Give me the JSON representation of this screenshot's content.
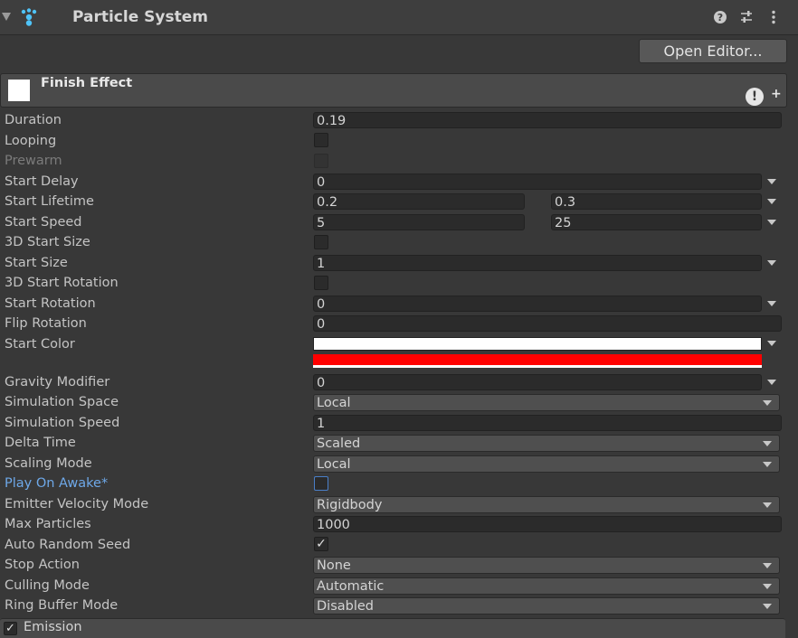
{
  "component": {
    "title": "Particle System",
    "open_editor_label": "Open Editor...",
    "help_icon": "help-icon",
    "presets_icon": "presets-icon",
    "menu_icon": "kebab-menu-icon"
  },
  "module": {
    "name": "Finish Effect",
    "swatch_color": "#ffffff",
    "warning_glyph": "!",
    "plus_glyph": "+"
  },
  "rows": {
    "duration": {
      "label": "Duration",
      "value": "0.19"
    },
    "looping": {
      "label": "Looping",
      "checked": false
    },
    "prewarm": {
      "label": "Prewarm",
      "checked": false,
      "disabled": true
    },
    "start_delay": {
      "label": "Start Delay",
      "value": "0"
    },
    "start_lifetime": {
      "label": "Start Lifetime",
      "min": "0.2",
      "max": "0.3"
    },
    "start_speed": {
      "label": "Start Speed",
      "min": "5",
      "max": "25"
    },
    "start_size_3d": {
      "label": "3D Start Size",
      "checked": false
    },
    "start_size": {
      "label": "Start Size",
      "value": "1"
    },
    "start_rotation_3d": {
      "label": "3D Start Rotation",
      "checked": false
    },
    "start_rotation": {
      "label": "Start Rotation",
      "value": "0"
    },
    "flip_rotation": {
      "label": "Flip Rotation",
      "value": "0"
    },
    "start_color": {
      "label": "Start Color",
      "color_a": "#ffffff",
      "color_b": "#ff0000"
    },
    "gravity_modifier": {
      "label": "Gravity Modifier",
      "value": "0"
    },
    "simulation_space": {
      "label": "Simulation Space",
      "value": "Local"
    },
    "simulation_speed": {
      "label": "Simulation Speed",
      "value": "1"
    },
    "delta_time": {
      "label": "Delta Time",
      "value": "Scaled"
    },
    "scaling_mode": {
      "label": "Scaling Mode",
      "value": "Local"
    },
    "play_on_awake": {
      "label": "Play On Awake*",
      "checked": false
    },
    "emitter_velocity_mode": {
      "label": "Emitter Velocity Mode",
      "value": "Rigidbody"
    },
    "max_particles": {
      "label": "Max Particles",
      "value": "1000"
    },
    "auto_random_seed": {
      "label": "Auto Random Seed",
      "checked": true,
      "check_glyph": "✓"
    },
    "stop_action": {
      "label": "Stop Action",
      "value": "None"
    },
    "culling_mode": {
      "label": "Culling Mode",
      "value": "Automatic"
    },
    "ring_buffer_mode": {
      "label": "Ring Buffer Mode",
      "value": "Disabled"
    }
  },
  "emission": {
    "label": "Emission",
    "checked": true,
    "check_glyph": "✓"
  }
}
